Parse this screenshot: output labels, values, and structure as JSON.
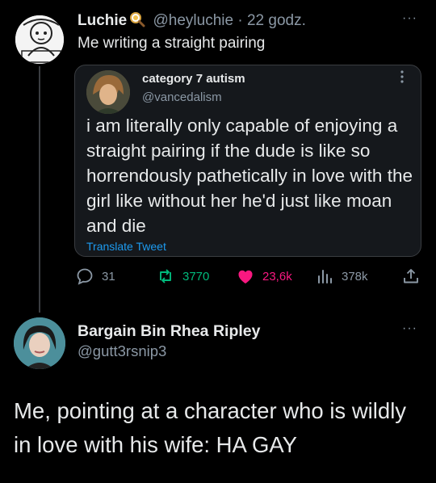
{
  "tweet1": {
    "author_name": "Luchie",
    "handle": "@heyluchie",
    "separator": "·",
    "time": "22 godz.",
    "text": "Me writing a straight pairing",
    "more": "···"
  },
  "quote": {
    "author_name": "category 7 autism",
    "handle": "@vancedalism",
    "text": "i am literally only capable of enjoying a straight pairing if the dude is like so horrendously pathetically in love with the girl like without her he'd just like moan and die",
    "translate_label": "Translate Tweet",
    "more": "⋮"
  },
  "actions": {
    "replies": "31",
    "retweets": "3770",
    "likes": "23,6k",
    "views": "378k"
  },
  "colors": {
    "retweet": "#00ba7c",
    "like": "#f91880",
    "link": "#1d9bf0",
    "secondary": "#8b98a5"
  },
  "tweet2": {
    "author_name": "Bargain Bin Rhea Ripley",
    "handle": "@gutt3rsnip3",
    "text": "Me, pointing at a character who is wildly in love with his wife: HA GAY",
    "more": "···"
  }
}
